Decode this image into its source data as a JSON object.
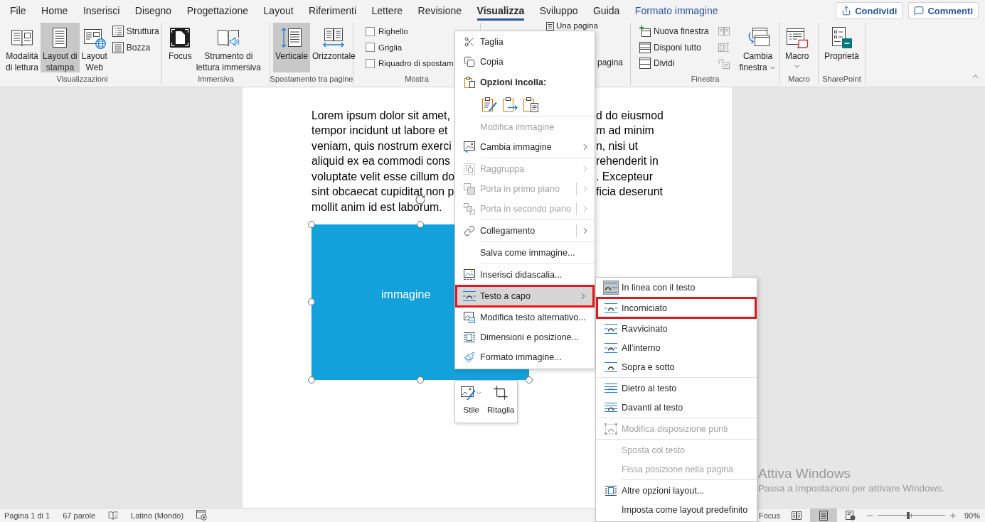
{
  "ribbon_tabs": [
    {
      "label": "File",
      "kind": "standard",
      "selected": false
    },
    {
      "label": "Home",
      "kind": "standard",
      "selected": false
    },
    {
      "label": "Inserisci",
      "kind": "standard",
      "selected": false
    },
    {
      "label": "Disegno",
      "kind": "standard",
      "selected": false
    },
    {
      "label": "Progettazione",
      "kind": "standard",
      "selected": false
    },
    {
      "label": "Layout",
      "kind": "standard",
      "selected": false
    },
    {
      "label": "Riferimenti",
      "kind": "standard",
      "selected": false
    },
    {
      "label": "Lettere",
      "kind": "standard",
      "selected": false
    },
    {
      "label": "Revisione",
      "kind": "standard",
      "selected": false
    },
    {
      "label": "Visualizza",
      "kind": "standard",
      "selected": true
    },
    {
      "label": "Sviluppo",
      "kind": "standard",
      "selected": false
    },
    {
      "label": "Guida",
      "kind": "standard",
      "selected": false
    },
    {
      "label": "Formato immagine",
      "kind": "contextual",
      "selected": false
    }
  ],
  "share_button": {
    "label": "Condividi"
  },
  "comments_button": {
    "label": "Commenti"
  },
  "ribbon_groups": [
    {
      "kind": "standard",
      "label": "Visualizzazioni",
      "items": [
        {
          "kind": "large",
          "label": "Modalità\ndi lettura",
          "selected": false,
          "dropdown": false
        },
        {
          "kind": "large",
          "label": "Layout di\nstampa",
          "selected": true,
          "dropdown": false
        },
        {
          "kind": "large",
          "label": "Layout\nWeb",
          "selected": false,
          "dropdown": false
        },
        {
          "kind": "small",
          "label": "Struttura"
        },
        {
          "kind": "small",
          "label": "Bozza"
        }
      ]
    },
    {
      "kind": "standard",
      "label": "Immersiva",
      "items": [
        {
          "kind": "large",
          "label": "Focus",
          "selected": false,
          "dropdown": false
        },
        {
          "kind": "large",
          "label": "Strumento di\nlettura immersiva",
          "selected": false,
          "dropdown": false
        }
      ]
    },
    {
      "kind": "standard",
      "label": "Spostamento tra pagine",
      "items": [
        {
          "kind": "large",
          "label": "Verticale",
          "selected": true,
          "dropdown": false
        },
        {
          "kind": "large",
          "label": "Orizzontale",
          "selected": false,
          "dropdown": false
        }
      ]
    },
    {
      "kind": "standard",
      "label": "Mostra",
      "items": [
        {
          "kind": "checkbox",
          "label": "Righello",
          "checked": false
        },
        {
          "kind": "checkbox",
          "label": "Griglia",
          "checked": false
        },
        {
          "kind": "checkbox",
          "label": "Riquadro di spostam",
          "checked": false
        }
      ]
    },
    {
      "kind": "covered",
      "items": [
        {
          "kind": "small",
          "label": "Una pagina"
        },
        {
          "kind": "small",
          "label": "pagina"
        }
      ]
    },
    {
      "kind": "standard",
      "label": "Finestra",
      "items": [
        {
          "kind": "small",
          "label": "Nuova finestra"
        },
        {
          "kind": "small",
          "label": "Disponi tutto"
        },
        {
          "kind": "small",
          "label": "Dividi"
        },
        {
          "kind": "icon",
          "disabled": true
        },
        {
          "kind": "icon",
          "disabled": true
        },
        {
          "kind": "icon",
          "disabled": true
        },
        {
          "kind": "large",
          "label": "Cambia\nfinestra",
          "selected": false,
          "dropdown": true
        }
      ]
    },
    {
      "kind": "standard",
      "label": "Macro",
      "items": [
        {
          "kind": "split",
          "label": "Macro",
          "selected": false
        }
      ]
    },
    {
      "kind": "standard",
      "label": "SharePoint",
      "items": [
        {
          "kind": "large",
          "label": "Proprietà",
          "selected": false,
          "dropdown": false
        }
      ]
    }
  ],
  "document": {
    "lines": [
      {
        "left": "Lorem ipsum dolor sit amet,",
        "right": "d do eiusmod"
      },
      {
        "left": "tempor incidunt ut labore et",
        "right": "m ad minim"
      },
      {
        "left": "veniam, quis nostrum exerci",
        "right": "n, nisi ut"
      },
      {
        "left": "aliquid ex ea commodi cons",
        "right": "rehenderit in"
      },
      {
        "left": "voluptate velit esse cillum do",
        "right": ". Excepteur"
      },
      {
        "left": "sint obcaecat cupiditat non p",
        "right": "ficia deserunt"
      },
      {
        "left": "mollit anim id est laborum."
      }
    ],
    "image": {
      "label": "immagine",
      "selected": true
    }
  },
  "context_menu": {
    "items": [
      {
        "kind": "item",
        "label": "Taglia",
        "disabled": false,
        "selected": false,
        "outlined": false,
        "submenu": false
      },
      {
        "kind": "item",
        "label": "Copia",
        "disabled": false,
        "selected": false,
        "outlined": false,
        "submenu": false
      },
      {
        "kind": "header",
        "label": "Opzioni Incolla:"
      },
      {
        "kind": "paste_options"
      },
      {
        "kind": "separator",
        "indented": true
      },
      {
        "kind": "item",
        "label": "Modifica immagine",
        "disabled": true,
        "selected": false,
        "outlined": false,
        "submenu": false
      },
      {
        "kind": "item",
        "label": "Cambia immagine",
        "disabled": false,
        "selected": false,
        "outlined": false,
        "submenu": true,
        "split": false
      },
      {
        "kind": "separator",
        "indented": true
      },
      {
        "kind": "item",
        "label": "Raggruppa",
        "disabled": true,
        "selected": false,
        "outlined": false,
        "submenu": true,
        "split": false
      },
      {
        "kind": "item",
        "label": "Porta in primo piano",
        "disabled": true,
        "selected": false,
        "outlined": false,
        "submenu": true,
        "split": true
      },
      {
        "kind": "item",
        "label": "Porta in secondo piano",
        "disabled": true,
        "selected": false,
        "outlined": false,
        "submenu": true,
        "split": true
      },
      {
        "kind": "separator",
        "indented": true
      },
      {
        "kind": "item",
        "label": "Collegamento",
        "disabled": false,
        "selected": false,
        "outlined": false,
        "submenu": true,
        "split": true
      },
      {
        "kind": "separator",
        "indented": true
      },
      {
        "kind": "item",
        "label": "Salva come immagine...",
        "disabled": false,
        "selected": false,
        "outlined": false,
        "submenu": false
      },
      {
        "kind": "separator",
        "indented": true
      },
      {
        "kind": "item",
        "label": "Inserisci didascalia...",
        "disabled": false,
        "selected": false,
        "outlined": false,
        "submenu": false
      },
      {
        "kind": "item",
        "label": "Testo a capo",
        "disabled": false,
        "selected": true,
        "outlined": true,
        "submenu": true,
        "split": false
      },
      {
        "kind": "item",
        "label": "Modifica testo alternativo...",
        "disabled": false,
        "selected": false,
        "outlined": false,
        "submenu": false
      },
      {
        "kind": "item",
        "label": "Dimensioni e posizione...",
        "disabled": false,
        "selected": false,
        "outlined": false,
        "submenu": false
      },
      {
        "kind": "item",
        "label": "Formato immagine...",
        "disabled": false,
        "selected": false,
        "outlined": false,
        "submenu": false
      }
    ]
  },
  "mini_toolbar": {
    "buttons": [
      {
        "label": "Stile",
        "dropdown": true
      },
      {
        "label": "Ritaglia",
        "dropdown": false
      }
    ]
  },
  "wrap_submenu": {
    "items": [
      {
        "kind": "item",
        "label": "In linea con il testo",
        "checked": true,
        "selected": false,
        "outlined": false,
        "disabled": false
      },
      {
        "kind": "item",
        "label": "Incorniciato",
        "checked": false,
        "selected": false,
        "outlined": true,
        "disabled": false
      },
      {
        "kind": "item",
        "label": "Ravvicinato",
        "checked": false,
        "selected": false,
        "outlined": false,
        "disabled": false
      },
      {
        "kind": "item",
        "label": "All'interno",
        "checked": false,
        "selected": false,
        "outlined": false,
        "disabled": false
      },
      {
        "kind": "item",
        "label": "Sopra e sotto",
        "checked": false,
        "selected": false,
        "outlined": false,
        "disabled": false
      },
      {
        "kind": "separator",
        "indented": false
      },
      {
        "kind": "item",
        "label": "Dietro al testo",
        "checked": false,
        "selected": false,
        "outlined": false,
        "disabled": false
      },
      {
        "kind": "item",
        "label": "Davanti al testo",
        "checked": false,
        "selected": false,
        "outlined": false,
        "disabled": false
      },
      {
        "kind": "separator",
        "indented": false
      },
      {
        "kind": "item",
        "label": "Modifica disposizione punti",
        "checked": false,
        "selected": false,
        "outlined": false,
        "disabled": true
      },
      {
        "kind": "separator",
        "indented": false
      },
      {
        "kind": "item",
        "label": "Sposta col testo",
        "checked": false,
        "selected": false,
        "outlined": false,
        "disabled": true
      },
      {
        "kind": "item",
        "label": "Fissa posizione nella pagina",
        "checked": false,
        "selected": false,
        "outlined": false,
        "disabled": true
      },
      {
        "kind": "separator",
        "indented": true
      },
      {
        "kind": "item",
        "label": "Altre opzioni layout...",
        "checked": false,
        "selected": false,
        "outlined": false,
        "disabled": false
      },
      {
        "kind": "item",
        "label": "Imposta come layout predefinito",
        "checked": false,
        "selected": false,
        "outlined": false,
        "disabled": false
      }
    ]
  },
  "activation_notice": {
    "title": "Attiva Windows",
    "message": "Passa a Impostazioni per attivare Windows."
  },
  "status_bar": {
    "page": "Pagina 1 di 1",
    "words": "67 parole",
    "language": "Latino (Mondo)",
    "focus": "Focus",
    "views": [
      {
        "selected": false
      },
      {
        "selected": true
      },
      {
        "selected": false
      }
    ],
    "zoom": {
      "level": 0.45,
      "reading": "90%"
    }
  }
}
